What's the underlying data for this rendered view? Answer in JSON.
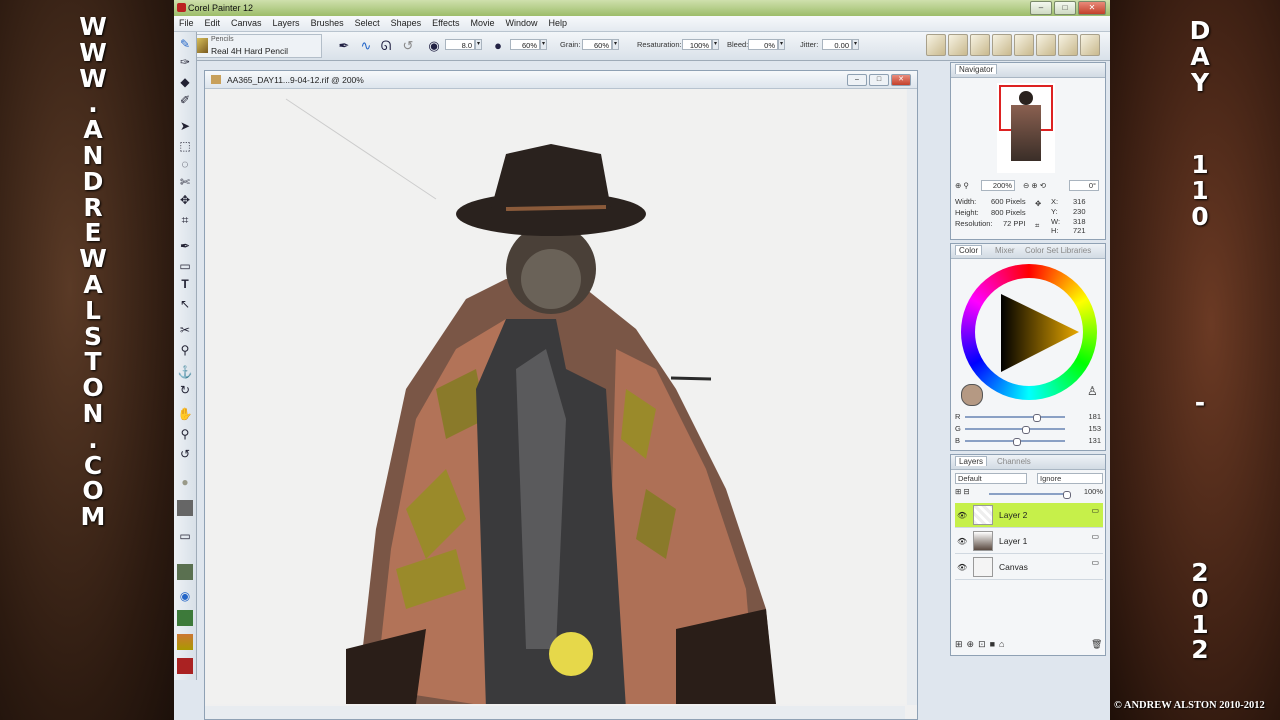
{
  "overlay": {
    "left_text": "WWW.ANDREWALSTON.COM",
    "right_day": "DAY",
    "right_num": "110",
    "right_dash": "-",
    "right_year": "2012",
    "copyright": "© ANDREW ALSTON 2010-2012"
  },
  "app": {
    "title": "Corel Painter 12",
    "window_buttons": {
      "minimize": "–",
      "maximize": "□",
      "close": "✕"
    }
  },
  "menu": [
    "File",
    "Edit",
    "Canvas",
    "Layers",
    "Brushes",
    "Select",
    "Shapes",
    "Effects",
    "Movie",
    "Window",
    "Help"
  ],
  "property_bar": {
    "category": "Pencils",
    "variant": "Real 4H Hard Pencil",
    "size": "8.0",
    "opacity": "60%",
    "grain_label": "Grain:",
    "grain": "60%",
    "resaturation_label": "Resaturation:",
    "resaturation": "100%",
    "bleed_label": "Bleed:",
    "bleed": "0%",
    "jitter_label": "Jitter:",
    "jitter": "0.00"
  },
  "document": {
    "title": "AA365_DAY11...9-04-12.rif @ 200%"
  },
  "navigator": {
    "title": "Navigator",
    "zoom": "200%",
    "rotation": "0°",
    "width_label": "Width:",
    "width": "600 Pixels",
    "height_label": "Height:",
    "height": "800 Pixels",
    "resolution_label": "Resolution:",
    "resolution": "72 PPI",
    "x_label": "X:",
    "x": "316",
    "y_label": "Y:",
    "y": "230",
    "w_label": "W:",
    "w": "318",
    "h_label": "H:",
    "h": "721"
  },
  "color": {
    "tabs": [
      "Color",
      "Mixer",
      "Color Set Libraries"
    ],
    "r_label": "R",
    "r": "181",
    "g_label": "G",
    "g": "153",
    "b_label": "B",
    "b": "131",
    "r_fraction": 0.71,
    "g_fraction": 0.6,
    "b_fraction": 0.51
  },
  "layers": {
    "tabs": [
      "Layers",
      "Channels"
    ],
    "composite_method": "Default",
    "depth": "Ignore",
    "opacity": "100%",
    "items": [
      {
        "name": "Layer 2",
        "selected": true
      },
      {
        "name": "Layer 1",
        "selected": false
      },
      {
        "name": "Canvas",
        "selected": false
      }
    ]
  }
}
